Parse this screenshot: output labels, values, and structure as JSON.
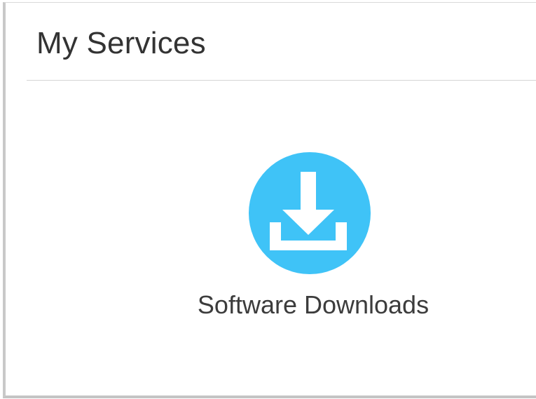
{
  "panel": {
    "title": "My Services"
  },
  "services": [
    {
      "label": "Software Downloads",
      "icon": "download-icon",
      "icon_color": "#3FC3F7"
    }
  ],
  "colors": {
    "accent": "#3FC3F7",
    "title_text": "#333333",
    "label_text": "#3C3C3C",
    "divider": "#D4D4D4"
  }
}
